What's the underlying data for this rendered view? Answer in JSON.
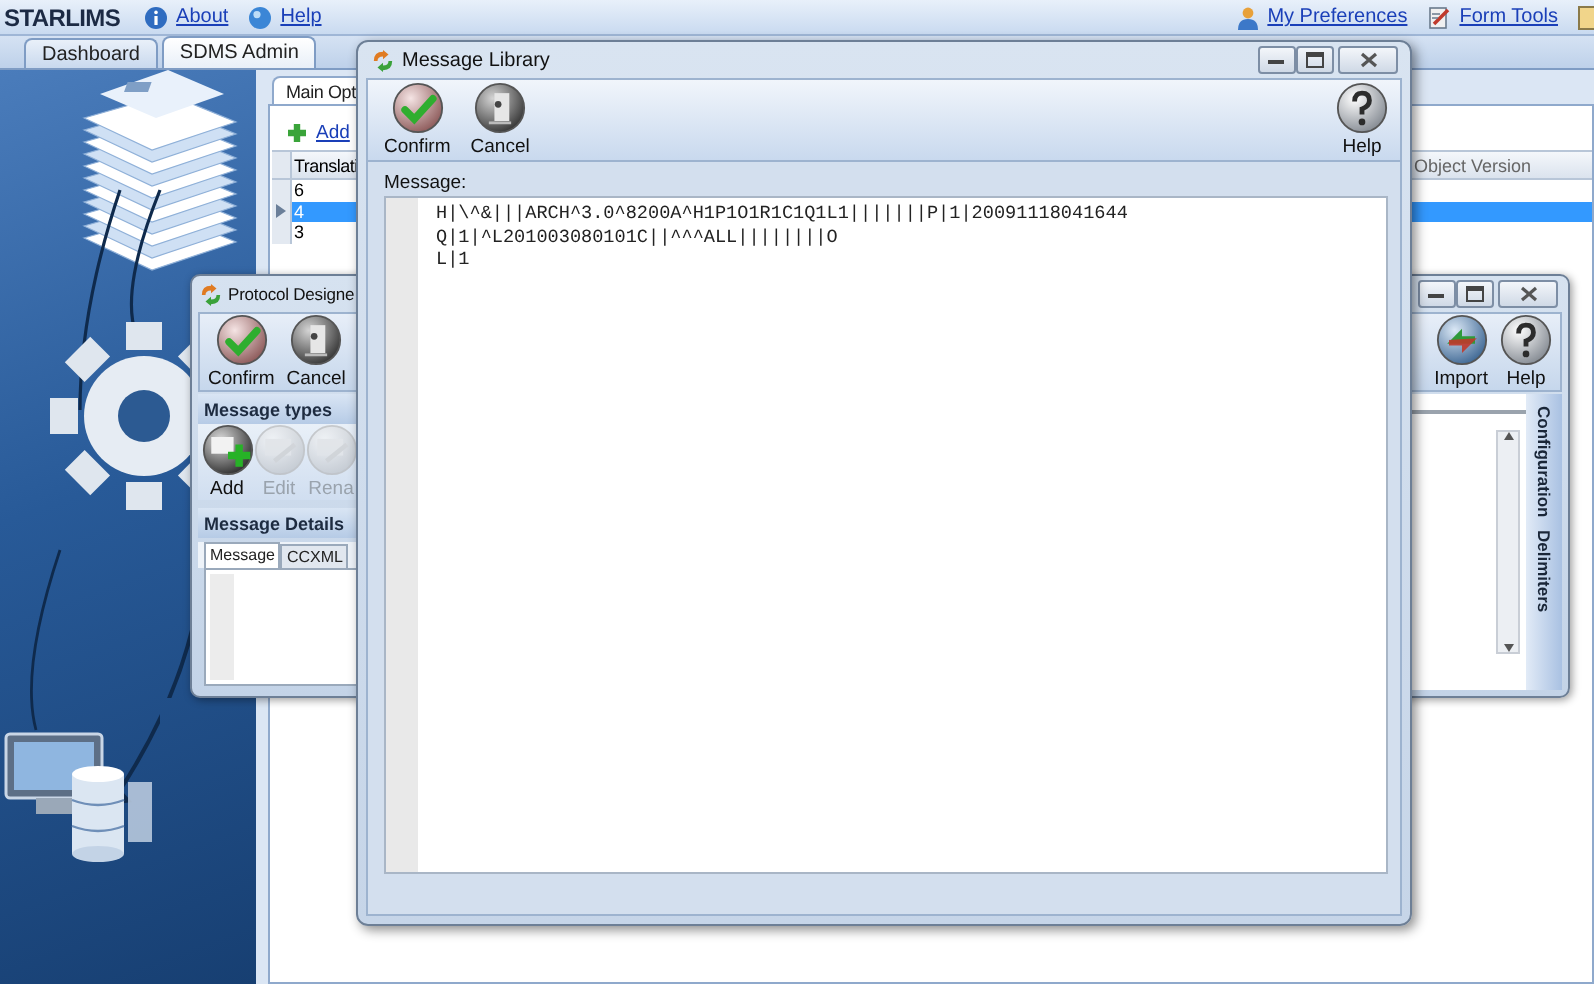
{
  "header": {
    "logo": "STARLIMS",
    "links": [
      {
        "label": "About",
        "kind": "info"
      },
      {
        "label": "Help",
        "kind": "help"
      }
    ],
    "right_links": [
      {
        "label": "My Preferences",
        "kind": "user"
      },
      {
        "label": "Form Tools",
        "kind": "tools"
      }
    ]
  },
  "tabs": [
    {
      "label": "Dashboard",
      "selected": false
    },
    {
      "label": "SDMS Admin",
      "selected": true
    }
  ],
  "main": {
    "tabs": [
      {
        "label": "Main Opt",
        "selected": true
      }
    ],
    "add_link": "Add",
    "table": {
      "columns": [
        "Translati",
        "Object Version"
      ],
      "rows": [
        {
          "cells": [
            "6"
          ],
          "selected": false
        },
        {
          "cells": [
            "4"
          ],
          "selected": true
        },
        {
          "cells": [
            "3"
          ],
          "selected": false
        }
      ]
    }
  },
  "protocol_designer": {
    "title": "Protocol Designe",
    "toolbar": [
      {
        "label": "Confirm",
        "kind": "confirm"
      },
      {
        "label": "Cancel",
        "kind": "cancel"
      }
    ],
    "right_toolbar": [
      {
        "label": "Import",
        "kind": "import"
      },
      {
        "label": "Help",
        "kind": "help"
      }
    ],
    "message_types": {
      "title": "Message types",
      "buttons": [
        {
          "label": "Add",
          "kind": "add",
          "disabled": false
        },
        {
          "label": "Edit",
          "kind": "edit",
          "disabled": true
        },
        {
          "label": "Rena",
          "kind": "edit",
          "disabled": true
        }
      ]
    },
    "message_details": {
      "title": "Message Details",
      "tabs": [
        {
          "label": "Message",
          "selected": true
        },
        {
          "label": "CCXML",
          "selected": false
        }
      ]
    },
    "side_tabs": [
      "Configuration",
      "Delimiters"
    ]
  },
  "message_library": {
    "title": "Message Library",
    "toolbar": [
      {
        "label": "Confirm",
        "kind": "confirm"
      },
      {
        "label": "Cancel",
        "kind": "cancel"
      },
      {
        "label": "Help",
        "kind": "help"
      }
    ],
    "message_label": "Message:",
    "message_lines": [
      "H|\\^&|||ARCH^3.0^8200A^H1P1O1R1C1Q1L1|||||||P|1|20091118041644",
      "Q|1|^L201003080101C||^^^ALL||||||||O",
      "L|1"
    ]
  }
}
